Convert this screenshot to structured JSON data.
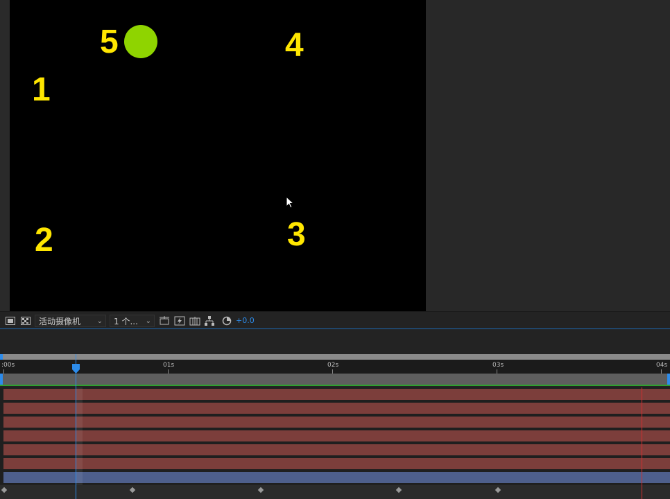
{
  "composition": {
    "labels": [
      "1",
      "2",
      "3",
      "4",
      "5"
    ],
    "colors": {
      "numbers": "#ffe600",
      "dot": "#8fd400",
      "background": "#000000"
    }
  },
  "viewer_toolbar": {
    "camera_view": "活动摄像机",
    "views_count": "1 个...",
    "exposure": "+0.0",
    "icons": [
      "region-of-interest-icon",
      "transparency-grid-icon",
      "reset-view-icon",
      "fast-preview-icon",
      "timeline-icon",
      "flowchart-icon",
      "reset-exposure-icon"
    ]
  },
  "timeline": {
    "time_labels": [
      ":00s",
      "01s",
      "02s",
      "03s",
      "04s"
    ],
    "layer_count": 7,
    "layer_colors": {
      "red": "#7c3e3b",
      "blue": "#4e5f8c"
    },
    "playhead_color": "#2d8ceb",
    "work_area_end_color": "#d23030"
  }
}
